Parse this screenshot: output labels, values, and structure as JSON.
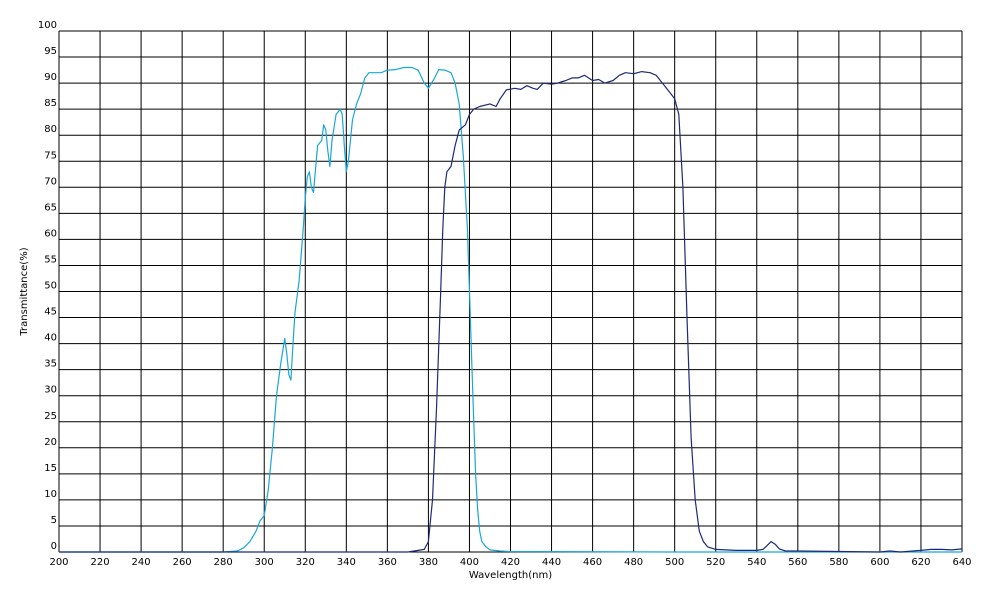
{
  "chart_data": {
    "type": "line",
    "title": "",
    "xlabel": "Wavelength(nm)",
    "ylabel": "Transmittance(%)",
    "xlim": [
      200,
      640
    ],
    "ylim": [
      0,
      100
    ],
    "grid": true,
    "x_ticks": [
      200,
      220,
      240,
      260,
      280,
      300,
      320,
      340,
      360,
      380,
      400,
      420,
      440,
      460,
      480,
      500,
      520,
      540,
      560,
      580,
      600,
      620,
      640
    ],
    "y_ticks": [
      0,
      5,
      10,
      15,
      20,
      25,
      30,
      35,
      40,
      45,
      50,
      55,
      60,
      65,
      70,
      75,
      80,
      85,
      90,
      95,
      100
    ],
    "colors": {
      "series_1": "#1aa6d8",
      "series_2": "#1c2a7a",
      "grid": "#000000"
    },
    "series": [
      {
        "color": "#1aa6d8",
        "points": [
          [
            200,
            0
          ],
          [
            280,
            0
          ],
          [
            287,
            0.2
          ],
          [
            290,
            0.8
          ],
          [
            293,
            2
          ],
          [
            296,
            4
          ],
          [
            298,
            6
          ],
          [
            300,
            7
          ],
          [
            302,
            12
          ],
          [
            304,
            20
          ],
          [
            306,
            30
          ],
          [
            308,
            36
          ],
          [
            310,
            41
          ],
          [
            311,
            38
          ],
          [
            312,
            34
          ],
          [
            313,
            33
          ],
          [
            314,
            40
          ],
          [
            315,
            46
          ],
          [
            317,
            52
          ],
          [
            319,
            62
          ],
          [
            320,
            68
          ],
          [
            321,
            72
          ],
          [
            322,
            73
          ],
          [
            323,
            70
          ],
          [
            324,
            69
          ],
          [
            326,
            78
          ],
          [
            328,
            79
          ],
          [
            329,
            82
          ],
          [
            330,
            81
          ],
          [
            331,
            77
          ],
          [
            332,
            74
          ],
          [
            333,
            79
          ],
          [
            335,
            84
          ],
          [
            337,
            85
          ],
          [
            338,
            84
          ],
          [
            339,
            78
          ],
          [
            340,
            73
          ],
          [
            341,
            75
          ],
          [
            343,
            83
          ],
          [
            345,
            86
          ],
          [
            347,
            88
          ],
          [
            349,
            91
          ],
          [
            351,
            92
          ],
          [
            354,
            92
          ],
          [
            357,
            92
          ],
          [
            360,
            92.5
          ],
          [
            364,
            92.6
          ],
          [
            368,
            93
          ],
          [
            372,
            93
          ],
          [
            375,
            92.5
          ],
          [
            378,
            90
          ],
          [
            380,
            89
          ],
          [
            383,
            91
          ],
          [
            385,
            92.6
          ],
          [
            388,
            92.5
          ],
          [
            391,
            92
          ],
          [
            393,
            90
          ],
          [
            395,
            86
          ],
          [
            397,
            76
          ],
          [
            399,
            62
          ],
          [
            400,
            50
          ],
          [
            401,
            38
          ],
          [
            402,
            26
          ],
          [
            403,
            15
          ],
          [
            404,
            8
          ],
          [
            405,
            4
          ],
          [
            406,
            2
          ],
          [
            408,
            1
          ],
          [
            410,
            0.4
          ],
          [
            415,
            0.2
          ],
          [
            420,
            0.1
          ],
          [
            500,
            0
          ],
          [
            640,
            0
          ]
        ]
      },
      {
        "color": "#1c2a7a",
        "points": [
          [
            200,
            0
          ],
          [
            370,
            0
          ],
          [
            378,
            0.5
          ],
          [
            380,
            2
          ],
          [
            382,
            10
          ],
          [
            384,
            28
          ],
          [
            386,
            50
          ],
          [
            387,
            62
          ],
          [
            388,
            70
          ],
          [
            389,
            73
          ],
          [
            391,
            74
          ],
          [
            393,
            78
          ],
          [
            395,
            81
          ],
          [
            398,
            82
          ],
          [
            400,
            84
          ],
          [
            402,
            85
          ],
          [
            405,
            85.5
          ],
          [
            410,
            86
          ],
          [
            413,
            85.5
          ],
          [
            415,
            87
          ],
          [
            418,
            88.7
          ],
          [
            422,
            89
          ],
          [
            425,
            88.8
          ],
          [
            428,
            89.5
          ],
          [
            431,
            89
          ],
          [
            433,
            88.8
          ],
          [
            436,
            90
          ],
          [
            440,
            89.8
          ],
          [
            443,
            90
          ],
          [
            447,
            90.5
          ],
          [
            450,
            91
          ],
          [
            453,
            91
          ],
          [
            456,
            91.5
          ],
          [
            460,
            90.5
          ],
          [
            463,
            90.7
          ],
          [
            466,
            90
          ],
          [
            470,
            90.5
          ],
          [
            473,
            91.5
          ],
          [
            476,
            92
          ],
          [
            480,
            91.8
          ],
          [
            484,
            92.2
          ],
          [
            488,
            92
          ],
          [
            491,
            91.5
          ],
          [
            494,
            90
          ],
          [
            496,
            89
          ],
          [
            498,
            88
          ],
          [
            500,
            87
          ],
          [
            502,
            84
          ],
          [
            504,
            70
          ],
          [
            506,
            45
          ],
          [
            508,
            22
          ],
          [
            510,
            10
          ],
          [
            512,
            4
          ],
          [
            514,
            2
          ],
          [
            516,
            1
          ],
          [
            520,
            0.5
          ],
          [
            530,
            0.3
          ],
          [
            540,
            0.3
          ],
          [
            543,
            0.5
          ],
          [
            545,
            1.2
          ],
          [
            547,
            2
          ],
          [
            549,
            1.5
          ],
          [
            551,
            0.6
          ],
          [
            554,
            0.2
          ],
          [
            560,
            0.2
          ],
          [
            580,
            0.1
          ],
          [
            600,
            0
          ],
          [
            605,
            0.2
          ],
          [
            610,
            0
          ],
          [
            620,
            0.3
          ],
          [
            625,
            0.5
          ],
          [
            630,
            0.5
          ],
          [
            635,
            0.4
          ],
          [
            640,
            0.6
          ]
        ]
      }
    ]
  }
}
